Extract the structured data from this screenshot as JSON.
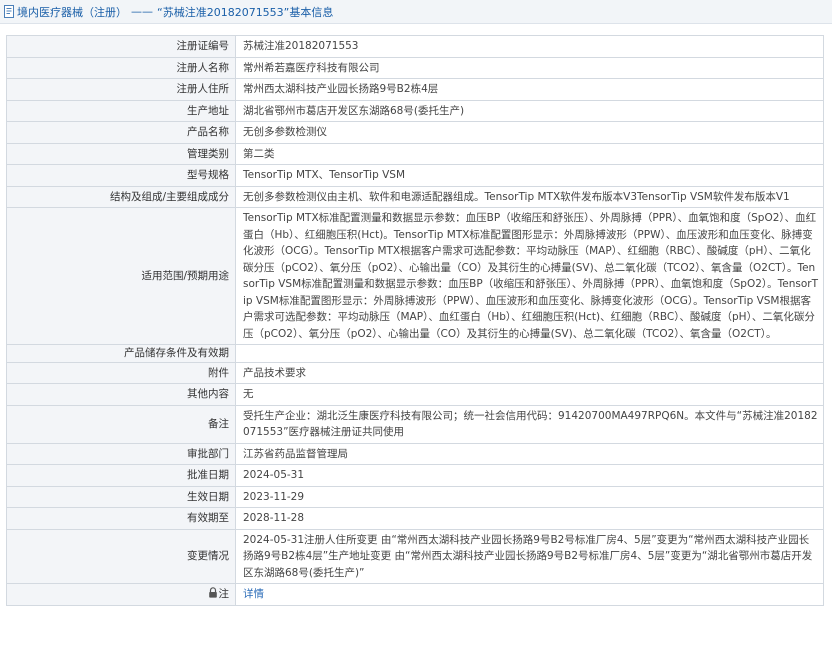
{
  "header": {
    "category": "境内医疗器械（注册）",
    "separator": "——",
    "title": "“苏械注准20182071553”基本信息"
  },
  "rows": [
    {
      "label": "注册证编号",
      "value": "苏械注准20182071553"
    },
    {
      "label": "注册人名称",
      "value": "常州希若嘉医疗科技有限公司"
    },
    {
      "label": "注册人住所",
      "value": "常州西太湖科技产业园长扬路9号B2栋4层"
    },
    {
      "label": "生产地址",
      "value": "湖北省鄂州市葛店开发区东湖路68号(委托生产)"
    },
    {
      "label": "产品名称",
      "value": "无创多参数检测仪"
    },
    {
      "label": "管理类别",
      "value": "第二类"
    },
    {
      "label": "型号规格",
      "value": "TensorTip MTX、TensorTip VSM"
    },
    {
      "label": "结构及组成/主要组成成分",
      "value": "无创多参数检测仪由主机、软件和电源适配器组成。TensorTip MTX软件发布版本V3TensorTip VSM软件发布版本V1"
    },
    {
      "label": "适用范围/预期用途",
      "value": "TensorTip MTX标准配置测量和数据显示参数：血压BP（收缩压和舒张压）、外周脉搏（PPR）、血氧饱和度（SpO2）、血红蛋白（Hb）、红细胞压积(Hct)。TensorTip MTX标准配置图形显示：外周脉搏波形（PPW）、血压波形和血压变化、脉搏变化波形（OCG）。TensorTip MTX根据客户需求可选配参数：平均动脉压（MAP）、红细胞（RBC）、酸碱度（pH）、二氧化碳分压（pCO2）、氧分压（pO2）、心输出量（CO）及其衍生的心搏量(SV)、总二氧化碳（TCO2）、氧含量（O2CT）。TensorTip VSM标准配置测量和数据显示参数：血压BP（收缩压和舒张压）、外周脉搏（PPR）、血氧饱和度（SpO2）。TensorTip VSM标准配置图形显示：外周脉搏波形（PPW）、血压波形和血压变化、脉搏变化波形（OCG）。TensorTip VSM根据客户需求可选配参数：平均动脉压（MAP）、血红蛋白（Hb）、红细胞压积(Hct)、红细胞（RBC）、酸碱度（pH）、二氧化碳分压（pCO2）、氧分压（pO2）、心输出量（CO）及其衍生的心搏量(SV)、总二氧化碳（TCO2）、氧含量（O2CT）。"
    },
    {
      "label": "产品储存条件及有效期",
      "value": ""
    },
    {
      "label": "附件",
      "value": "产品技术要求"
    },
    {
      "label": "其他内容",
      "value": "无"
    },
    {
      "label": "备注",
      "value": "受托生产企业：湖北泛生康医疗科技有限公司；统一社会信用代码：91420700MA497RPQ6N。本文件与“苏械注准20182071553”医疗器械注册证共同使用"
    },
    {
      "label": "审批部门",
      "value": "江苏省药品监督管理局"
    },
    {
      "label": "批准日期",
      "value": "2024-05-31"
    },
    {
      "label": "生效日期",
      "value": "2023-11-29"
    },
    {
      "label": "有效期至",
      "value": "2028-11-28"
    },
    {
      "label": "变更情况",
      "value": "2024-05-31注册人住所变更 由“常州西太湖科技产业园长扬路9号B2号标准厂房4、5层”变更为“常州西太湖科技产业园长扬路9号B2栋4层”生产地址变更 由“常州西太湖科技产业园长扬路9号B2号标准厂房4、5层”变更为“湖北省鄂州市葛店开发区东湖路68号(委托生产)”"
    }
  ],
  "footer": {
    "label": "注",
    "link": "详情",
    "icon": "lock-icon"
  },
  "colors": {
    "link": "#2b6cb8",
    "title": "#1a5fa8",
    "label_bg": "#f3f5f8",
    "border": "#d3d9e0"
  }
}
